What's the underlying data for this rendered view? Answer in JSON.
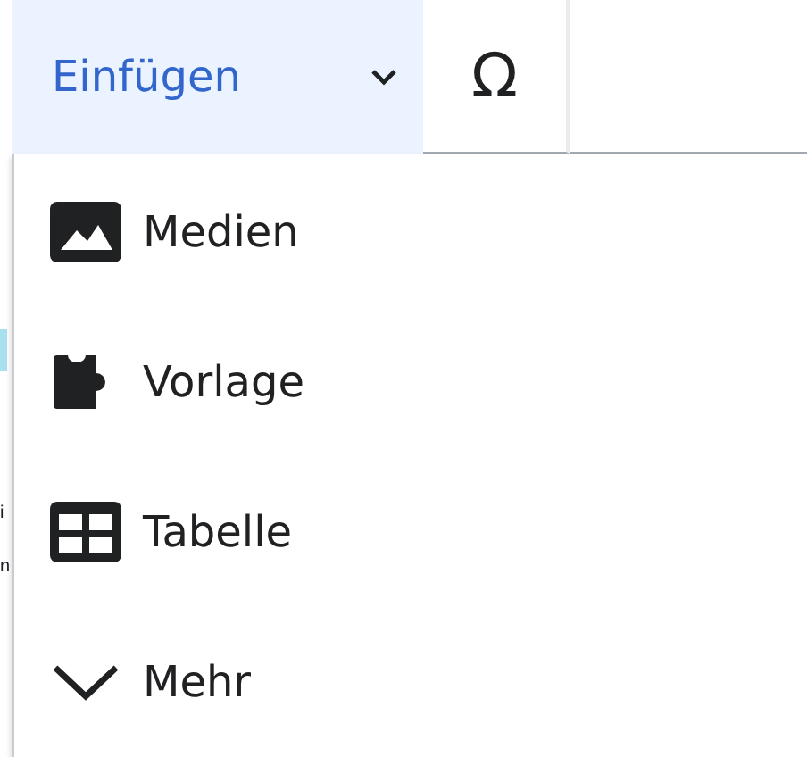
{
  "toolbar": {
    "insert_button": {
      "label": "Einfügen",
      "expanded": true
    },
    "special_character_button": {
      "label": "Ω"
    }
  },
  "background_fragments": [
    "i",
    "n"
  ],
  "menu": {
    "items": [
      {
        "kind": "media",
        "label": "Medien"
      },
      {
        "kind": "template",
        "label": "Vorlage"
      },
      {
        "kind": "table",
        "label": "Tabelle"
      },
      {
        "kind": "more",
        "label": "Mehr"
      }
    ]
  }
}
